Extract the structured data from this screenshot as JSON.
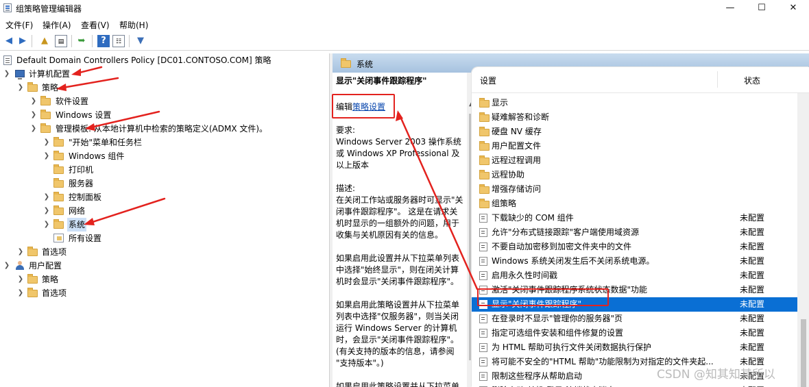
{
  "window": {
    "title": "组策略管理编辑器",
    "controls": [
      "—",
      "☐",
      "✕"
    ]
  },
  "menu": [
    "文件(F)",
    "操作(A)",
    "查看(V)",
    "帮助(H)"
  ],
  "toolbar": [
    "back-icon",
    "forward-icon",
    "up-folder-icon",
    "show-hide-tree-icon",
    "export-icon",
    "help-icon",
    "properties-icon",
    "filter-icon"
  ],
  "tree": {
    "root": "Default Domain Controllers Policy [DC01.CONTOSO.COM] 策略",
    "computer_config": "计算机配置",
    "policies": "策略",
    "software_settings": "软件设置",
    "windows_settings": "Windows 设置",
    "admin_templates": "管理模板: 从本地计算机中检索的策略定义(ADMX 文件)。",
    "start_menu": "\"开始\"菜单和任务栏",
    "windows_components": "Windows 组件",
    "printers": "打印机",
    "server": "服务器",
    "control_panel": "控制面板",
    "network": "网络",
    "system": "系统",
    "all_settings": "所有设置",
    "preferences": "首选项",
    "user_config": "用户配置",
    "user_policies": "策略",
    "user_preferences": "首选项"
  },
  "details": {
    "header": "系统",
    "setting_title": "显示\"关闭事件跟踪程序\"",
    "edit_prefix": "编辑",
    "edit_link": "策略设置",
    "requirements_label": "要求:",
    "requirements": [
      "Windows Server 2003 操作系统",
      "或 Windows XP Professional 及",
      "以上版本"
    ],
    "description_label": "描述:",
    "description": [
      "在关闭工作站或服务器时可显示\"关",
      "闭事件跟踪程序\"。 这是在请求关",
      "机时显示的一组额外的问题，用于",
      "收集与关机原因有关的信息。"
    ],
    "para2": [
      "如果启用此设置并从下拉菜单列表",
      "中选择\"始终显示\"，则在闭关计算",
      "机时会显示\"关闭事件跟踪程序\"。"
    ],
    "para3": [
      "如果启用此策略设置并从下拉菜单",
      "列表中选择\"仅服务器\"，则当关闭",
      "运行 Windows Server 的计算机",
      "时，会显示\"关闭事件跟踪程序\"。",
      "(有关支持的版本的信息，请参阅",
      "\"支持版本\"。)"
    ],
    "para4": "如果启用此策略设置并从下拉菜单"
  },
  "list": {
    "col_setting": "设置",
    "col_state": "状态",
    "folders": [
      "显示",
      "疑难解答和诊断",
      "硬盘 NV 缓存",
      "用户配置文件",
      "远程过程调用",
      "远程协助",
      "增强存储访问",
      "组策略"
    ],
    "settings": [
      {
        "name": "下载缺少的 COM 组件",
        "state": "未配置"
      },
      {
        "name": "允许\"分布式链接跟踪\"客户端使用域资源",
        "state": "未配置"
      },
      {
        "name": "不要自动加密移到加密文件夹中的文件",
        "state": "未配置"
      },
      {
        "name": "Windows 系统关闭发生后不关闭系统电源。",
        "state": "未配置"
      },
      {
        "name": "启用永久性时间戳",
        "state": "未配置"
      },
      {
        "name": "激活\"关闭事件跟踪程序系统状态数据\"功能",
        "state": "未配置"
      },
      {
        "name": "显示\"关闭事件跟踪程序\"",
        "state": "未配置"
      },
      {
        "name": "在登录时不显示\"管理你的服务器\"页",
        "state": "未配置"
      },
      {
        "name": "指定可选组件安装和组件修复的设置",
        "state": "未配置"
      },
      {
        "name": "为 HTML 帮助可执行文件关闭数据执行保护",
        "state": "未配置"
      },
      {
        "name": "将可能不安全的\"HTML 帮助\"功能限制为对指定的文件夹起...",
        "state": "未配置"
      },
      {
        "name": "限制这些程序从帮助启动",
        "state": "未配置"
      },
      {
        "name": "删除启动/关机/登录/注销状态消息",
        "state": "未配置"
      }
    ]
  },
  "watermark": "CSDN @知其知其所以",
  "colors": {
    "selection": "#0a6fd4",
    "annotation": "#e3221e",
    "link": "#0645ad"
  }
}
